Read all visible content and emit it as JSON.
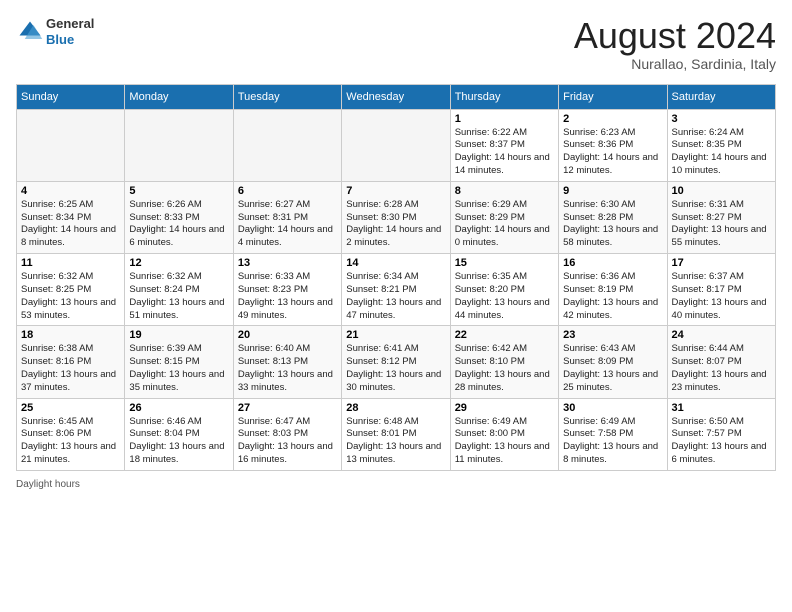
{
  "header": {
    "logo_general": "General",
    "logo_blue": "Blue",
    "month_year": "August 2024",
    "location": "Nurallao, Sardinia, Italy"
  },
  "weekdays": [
    "Sunday",
    "Monday",
    "Tuesday",
    "Wednesday",
    "Thursday",
    "Friday",
    "Saturday"
  ],
  "weeks": [
    [
      {
        "day": "",
        "info": ""
      },
      {
        "day": "",
        "info": ""
      },
      {
        "day": "",
        "info": ""
      },
      {
        "day": "",
        "info": ""
      },
      {
        "day": "1",
        "info": "Sunrise: 6:22 AM\nSunset: 8:37 PM\nDaylight: 14 hours and 14 minutes."
      },
      {
        "day": "2",
        "info": "Sunrise: 6:23 AM\nSunset: 8:36 PM\nDaylight: 14 hours and 12 minutes."
      },
      {
        "day": "3",
        "info": "Sunrise: 6:24 AM\nSunset: 8:35 PM\nDaylight: 14 hours and 10 minutes."
      }
    ],
    [
      {
        "day": "4",
        "info": "Sunrise: 6:25 AM\nSunset: 8:34 PM\nDaylight: 14 hours and 8 minutes."
      },
      {
        "day": "5",
        "info": "Sunrise: 6:26 AM\nSunset: 8:33 PM\nDaylight: 14 hours and 6 minutes."
      },
      {
        "day": "6",
        "info": "Sunrise: 6:27 AM\nSunset: 8:31 PM\nDaylight: 14 hours and 4 minutes."
      },
      {
        "day": "7",
        "info": "Sunrise: 6:28 AM\nSunset: 8:30 PM\nDaylight: 14 hours and 2 minutes."
      },
      {
        "day": "8",
        "info": "Sunrise: 6:29 AM\nSunset: 8:29 PM\nDaylight: 14 hours and 0 minutes."
      },
      {
        "day": "9",
        "info": "Sunrise: 6:30 AM\nSunset: 8:28 PM\nDaylight: 13 hours and 58 minutes."
      },
      {
        "day": "10",
        "info": "Sunrise: 6:31 AM\nSunset: 8:27 PM\nDaylight: 13 hours and 55 minutes."
      }
    ],
    [
      {
        "day": "11",
        "info": "Sunrise: 6:32 AM\nSunset: 8:25 PM\nDaylight: 13 hours and 53 minutes."
      },
      {
        "day": "12",
        "info": "Sunrise: 6:32 AM\nSunset: 8:24 PM\nDaylight: 13 hours and 51 minutes."
      },
      {
        "day": "13",
        "info": "Sunrise: 6:33 AM\nSunset: 8:23 PM\nDaylight: 13 hours and 49 minutes."
      },
      {
        "day": "14",
        "info": "Sunrise: 6:34 AM\nSunset: 8:21 PM\nDaylight: 13 hours and 47 minutes."
      },
      {
        "day": "15",
        "info": "Sunrise: 6:35 AM\nSunset: 8:20 PM\nDaylight: 13 hours and 44 minutes."
      },
      {
        "day": "16",
        "info": "Sunrise: 6:36 AM\nSunset: 8:19 PM\nDaylight: 13 hours and 42 minutes."
      },
      {
        "day": "17",
        "info": "Sunrise: 6:37 AM\nSunset: 8:17 PM\nDaylight: 13 hours and 40 minutes."
      }
    ],
    [
      {
        "day": "18",
        "info": "Sunrise: 6:38 AM\nSunset: 8:16 PM\nDaylight: 13 hours and 37 minutes."
      },
      {
        "day": "19",
        "info": "Sunrise: 6:39 AM\nSunset: 8:15 PM\nDaylight: 13 hours and 35 minutes."
      },
      {
        "day": "20",
        "info": "Sunrise: 6:40 AM\nSunset: 8:13 PM\nDaylight: 13 hours and 33 minutes."
      },
      {
        "day": "21",
        "info": "Sunrise: 6:41 AM\nSunset: 8:12 PM\nDaylight: 13 hours and 30 minutes."
      },
      {
        "day": "22",
        "info": "Sunrise: 6:42 AM\nSunset: 8:10 PM\nDaylight: 13 hours and 28 minutes."
      },
      {
        "day": "23",
        "info": "Sunrise: 6:43 AM\nSunset: 8:09 PM\nDaylight: 13 hours and 25 minutes."
      },
      {
        "day": "24",
        "info": "Sunrise: 6:44 AM\nSunset: 8:07 PM\nDaylight: 13 hours and 23 minutes."
      }
    ],
    [
      {
        "day": "25",
        "info": "Sunrise: 6:45 AM\nSunset: 8:06 PM\nDaylight: 13 hours and 21 minutes."
      },
      {
        "day": "26",
        "info": "Sunrise: 6:46 AM\nSunset: 8:04 PM\nDaylight: 13 hours and 18 minutes."
      },
      {
        "day": "27",
        "info": "Sunrise: 6:47 AM\nSunset: 8:03 PM\nDaylight: 13 hours and 16 minutes."
      },
      {
        "day": "28",
        "info": "Sunrise: 6:48 AM\nSunset: 8:01 PM\nDaylight: 13 hours and 13 minutes."
      },
      {
        "day": "29",
        "info": "Sunrise: 6:49 AM\nSunset: 8:00 PM\nDaylight: 13 hours and 11 minutes."
      },
      {
        "day": "30",
        "info": "Sunrise: 6:49 AM\nSunset: 7:58 PM\nDaylight: 13 hours and 8 minutes."
      },
      {
        "day": "31",
        "info": "Sunrise: 6:50 AM\nSunset: 7:57 PM\nDaylight: 13 hours and 6 minutes."
      }
    ]
  ],
  "footer": {
    "daylight_label": "Daylight hours"
  }
}
